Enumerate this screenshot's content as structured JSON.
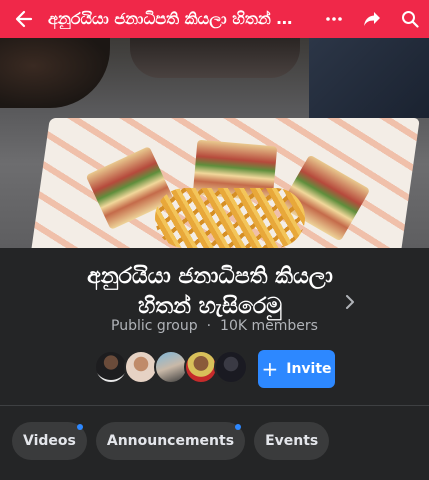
{
  "appbar": {
    "title": "අනුරයියා ජනාධිපති කියලා හිතන් හැ...",
    "icons": [
      "back-arrow-icon",
      "more-icon",
      "share-icon",
      "search-icon"
    ],
    "color": "#f02849"
  },
  "group": {
    "name_line1": "අනුරයියා ජනාධිපති කියලා",
    "name_line2": "හිතන් හැසිරෙමු",
    "privacy": "Public group",
    "separator": "·",
    "members": "10K members"
  },
  "invite": {
    "label": "Invite",
    "icon": "plus-icon",
    "color": "#2d88ff"
  },
  "tabs": [
    {
      "label": "Videos",
      "has_badge": true
    },
    {
      "label": "Announcements",
      "has_badge": true
    },
    {
      "label": "Events",
      "has_badge": false
    }
  ]
}
